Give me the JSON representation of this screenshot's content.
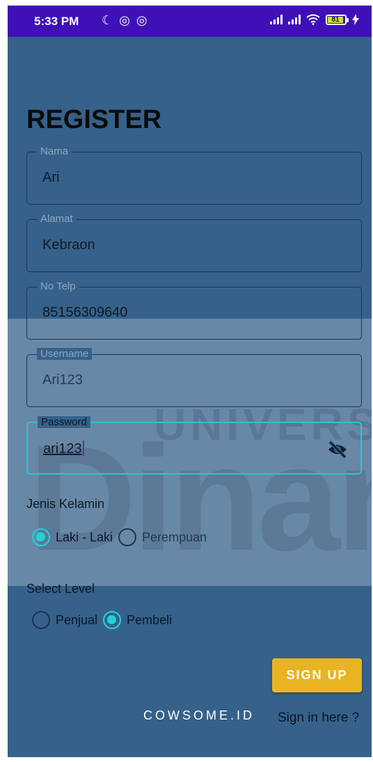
{
  "status_bar": {
    "time": "5:33 PM",
    "left_icons": [
      "moon-icon",
      "focus-icon",
      "focus-icon"
    ],
    "battery_level": "81"
  },
  "watermark": {
    "line1": "UNIVERSI",
    "line2": "Dinan"
  },
  "form": {
    "title": "REGISTER",
    "fields": [
      {
        "label": "Nama",
        "value": "Ari"
      },
      {
        "label": "Alamat",
        "value": "Kebraon"
      },
      {
        "label": "No Telp",
        "value": "85156309640"
      },
      {
        "label": "Username",
        "value": "Ari123"
      },
      {
        "label": "Password",
        "value": "ari123"
      }
    ],
    "gender": {
      "label": "Jenis Kelamin",
      "options": [
        "Laki - Laki",
        "Perempuan"
      ],
      "selected": "Laki - Laki"
    },
    "level": {
      "label": "Select Level",
      "options": [
        "Penjual",
        "Pembeli"
      ],
      "selected": "Pembeli"
    },
    "signup_label": "SIGN UP",
    "brand": "COWSOME.ID",
    "signin_link": "Sign in here ?"
  },
  "colors": {
    "background": "#36618a",
    "status_bar": "#3f10b8",
    "accent": "#20d3d6",
    "button": "#e9b422"
  }
}
